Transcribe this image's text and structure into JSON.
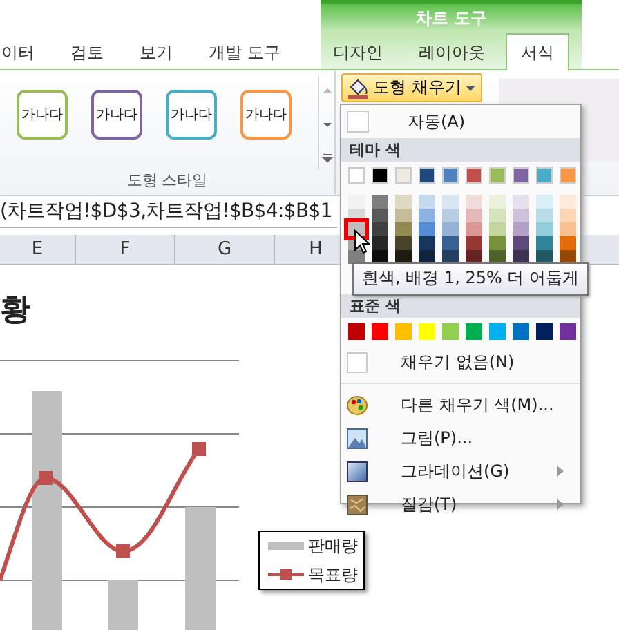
{
  "ribbon": {
    "context_group": "차트 도구",
    "tabs": [
      {
        "label": "이터",
        "selected": false
      },
      {
        "label": "검토",
        "selected": false
      },
      {
        "label": "보기",
        "selected": false
      },
      {
        "label": "개발 도구",
        "selected": false
      },
      {
        "label": "디자인",
        "selected": false
      },
      {
        "label": "레이아웃",
        "selected": false
      },
      {
        "label": "서식",
        "selected": true
      }
    ],
    "style_gallery": {
      "items": [
        {
          "label": "가나다",
          "color": "#9bbb59"
        },
        {
          "label": "가나다",
          "color": "#8064a2"
        },
        {
          "label": "가나다",
          "color": "#4bacc6"
        },
        {
          "label": "가나다",
          "color": "#f79646"
        }
      ],
      "group_label": "도형 스타일"
    },
    "fill_button": {
      "label": "도형 채우기",
      "active": true
    }
  },
  "formula_bar": {
    "text": "(차트작업!$D$3,차트작업!$B$4:$B$1"
  },
  "columns": [
    "E",
    "F",
    "G",
    "H"
  ],
  "chart": {
    "title": "황",
    "legend": [
      {
        "label": "판매량",
        "kind": "bar"
      },
      {
        "label": "목표량",
        "kind": "line"
      }
    ]
  },
  "fill_menu": {
    "automatic": "자동(A)",
    "theme_header": "테마 색",
    "theme_columns": [
      [
        {
          "color": "#ffffff",
          "selected": false
        },
        {
          "color": "#f2f2f2",
          "selected": false
        },
        {
          "color": "#d9d9d9",
          "selected": false
        },
        {
          "color": "#bfbfbf",
          "selected": true
        },
        {
          "color": "#a6a6a6",
          "selected": false
        },
        {
          "color": "#808080",
          "selected": false
        }
      ],
      [
        {
          "color": "#000000",
          "selected": false
        },
        {
          "color": "#7f7f7f",
          "selected": false
        },
        {
          "color": "#595959",
          "selected": false
        },
        {
          "color": "#404040",
          "selected": false
        },
        {
          "color": "#262626",
          "selected": false
        },
        {
          "color": "#0d0d0d",
          "selected": false
        }
      ],
      [
        {
          "color": "#eeece1",
          "selected": false
        },
        {
          "color": "#ddd9c3",
          "selected": false
        },
        {
          "color": "#c4bd97",
          "selected": false
        },
        {
          "color": "#938953",
          "selected": false
        },
        {
          "color": "#494429",
          "selected": false
        },
        {
          "color": "#1d1b10",
          "selected": false
        }
      ],
      [
        {
          "color": "#1f497d",
          "selected": false
        },
        {
          "color": "#c6d9f0",
          "selected": false
        },
        {
          "color": "#8db3e2",
          "selected": false
        },
        {
          "color": "#548dd4",
          "selected": false
        },
        {
          "color": "#17365d",
          "selected": false
        },
        {
          "color": "#0f243e",
          "selected": false
        }
      ],
      [
        {
          "color": "#4f81bd",
          "selected": false
        },
        {
          "color": "#dbe5f1",
          "selected": false
        },
        {
          "color": "#b8cce4",
          "selected": false
        },
        {
          "color": "#95b3d7",
          "selected": false
        },
        {
          "color": "#366092",
          "selected": false
        },
        {
          "color": "#244061",
          "selected": false
        }
      ],
      [
        {
          "color": "#c0504d",
          "selected": false
        },
        {
          "color": "#f2dcdb",
          "selected": false
        },
        {
          "color": "#e5b9b7",
          "selected": false
        },
        {
          "color": "#d99694",
          "selected": false
        },
        {
          "color": "#953734",
          "selected": false
        },
        {
          "color": "#632423",
          "selected": false
        }
      ],
      [
        {
          "color": "#9bbb59",
          "selected": false
        },
        {
          "color": "#ebf1dd",
          "selected": false
        },
        {
          "color": "#d7e3bc",
          "selected": false
        },
        {
          "color": "#c3d69b",
          "selected": false
        },
        {
          "color": "#76923c",
          "selected": false
        },
        {
          "color": "#4f6128",
          "selected": false
        }
      ],
      [
        {
          "color": "#8064a2",
          "selected": false
        },
        {
          "color": "#e5e0ec",
          "selected": false
        },
        {
          "color": "#ccc1d9",
          "selected": false
        },
        {
          "color": "#b2a2c7",
          "selected": false
        },
        {
          "color": "#5f497a",
          "selected": false
        },
        {
          "color": "#3f3151",
          "selected": false
        }
      ],
      [
        {
          "color": "#4bacc6",
          "selected": false
        },
        {
          "color": "#dbeef3",
          "selected": false
        },
        {
          "color": "#b7dde8",
          "selected": false
        },
        {
          "color": "#92cddc",
          "selected": false
        },
        {
          "color": "#31859b",
          "selected": false
        },
        {
          "color": "#205867",
          "selected": false
        }
      ],
      [
        {
          "color": "#f79646",
          "selected": false
        },
        {
          "color": "#fdeada",
          "selected": false
        },
        {
          "color": "#fbd5b5",
          "selected": false
        },
        {
          "color": "#fac08f",
          "selected": false
        },
        {
          "color": "#e36c09",
          "selected": false
        },
        {
          "color": "#974806",
          "selected": false
        }
      ]
    ],
    "standard_header": "표준 색",
    "standard_colors": [
      {
        "color": "#c00000",
        "selected": false
      },
      {
        "color": "#ff0000",
        "selected": false
      },
      {
        "color": "#ffc000",
        "selected": false
      },
      {
        "color": "#ffff00",
        "selected": false
      },
      {
        "color": "#92d050",
        "selected": false
      },
      {
        "color": "#00b050",
        "selected": false
      },
      {
        "color": "#00b0f0",
        "selected": false
      },
      {
        "color": "#0070c0",
        "selected": false
      },
      {
        "color": "#002060",
        "selected": false
      },
      {
        "color": "#7030a0",
        "selected": false
      }
    ],
    "items": [
      {
        "label": "채우기 없음(N)",
        "kind": "none",
        "submenu": false
      },
      {
        "label": "다른 채우기 색(M)...",
        "kind": "palette",
        "submenu": false
      },
      {
        "label": "그림(P)...",
        "kind": "picture",
        "submenu": false
      },
      {
        "label": "그라데이션(G)",
        "kind": "gradient",
        "submenu": true
      },
      {
        "label": "질감(T)",
        "kind": "texture",
        "submenu": true
      }
    ]
  },
  "tooltip": "흰색, 배경 1, 25% 더 어둡게"
}
